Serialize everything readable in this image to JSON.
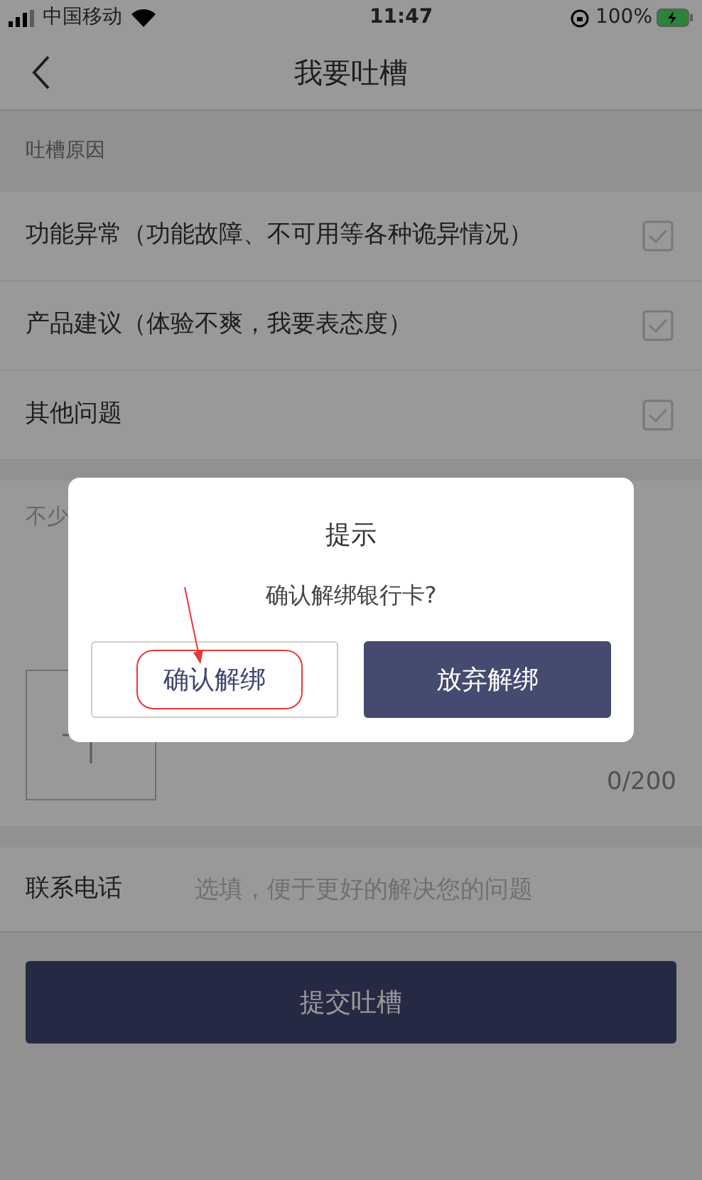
{
  "status_bar": {
    "carrier": "中国移动",
    "time": "11:47",
    "battery": "100%"
  },
  "nav": {
    "title": "我要吐槽"
  },
  "reasons": {
    "label": "吐槽原因",
    "items": [
      {
        "text": "功能异常（功能故障、不可用等各种诡异情况）",
        "checked": false
      },
      {
        "text": "产品建议（体验不爽，我要表态度）",
        "checked": false
      },
      {
        "text": "其他问题",
        "checked": false
      }
    ]
  },
  "feedback": {
    "placeholder": "不少",
    "counter": "0/200"
  },
  "contact": {
    "label": "联系电话",
    "placeholder": "选填，便于更好的解决您的问题"
  },
  "submit": "提交吐槽",
  "dialog": {
    "title": "提示",
    "message": "确认解绑银行卡?",
    "buttons": [
      {
        "label": "确认解绑",
        "kind": "secondary"
      },
      {
        "label": "放弃解绑",
        "kind": "primary"
      }
    ]
  }
}
